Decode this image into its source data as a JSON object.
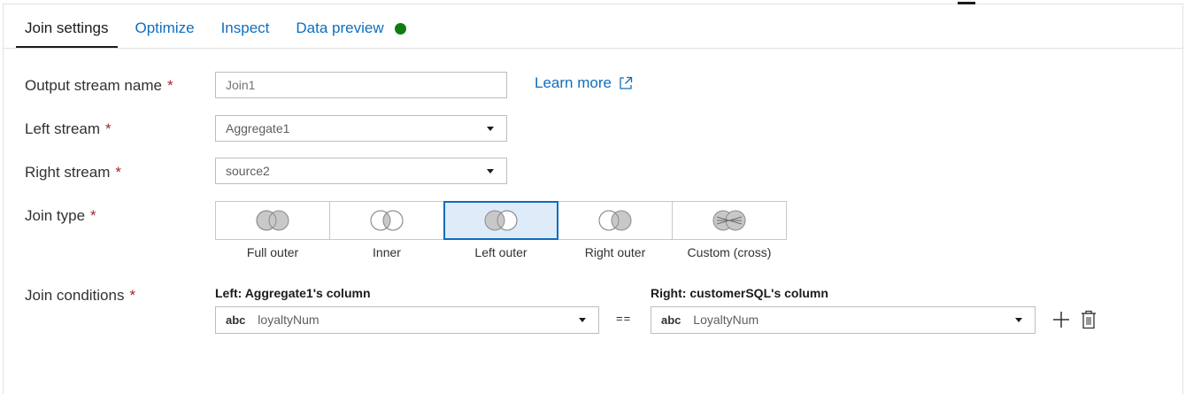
{
  "tabs": [
    {
      "label": "Join settings",
      "active": true
    },
    {
      "label": "Optimize",
      "active": false
    },
    {
      "label": "Inspect",
      "active": false
    },
    {
      "label": "Data preview",
      "active": false,
      "status_color": "#107c10"
    }
  ],
  "form": {
    "required_marker": "*",
    "output_stream": {
      "label": "Output stream name",
      "placeholder": "Join1",
      "value": ""
    },
    "learn_more": {
      "label": "Learn more",
      "icon": "external-link-icon"
    },
    "left_stream": {
      "label": "Left stream",
      "value": "Aggregate1"
    },
    "right_stream": {
      "label": "Right stream",
      "value": "source2"
    },
    "join_type": {
      "label": "Join type",
      "selected": "Left outer",
      "options": [
        {
          "label": "Full outer",
          "icon": "venn-full-outer-icon"
        },
        {
          "label": "Inner",
          "icon": "venn-inner-icon"
        },
        {
          "label": "Left outer",
          "icon": "venn-left-outer-icon"
        },
        {
          "label": "Right outer",
          "icon": "venn-right-outer-icon"
        },
        {
          "label": "Custom (cross)",
          "icon": "venn-cross-icon"
        }
      ]
    },
    "join_conditions": {
      "label": "Join conditions",
      "left_header": "Left: Aggregate1's column",
      "right_header": "Right: customerSQL's column",
      "operator": "==",
      "type_badge": "abc",
      "left_value": "loyaltyNum",
      "right_value": "LoyaltyNum"
    }
  },
  "colors": {
    "link": "#106ebe",
    "selected_border": "#0f6cbd",
    "selected_fill": "#deecf9",
    "required": "#a4262c"
  }
}
